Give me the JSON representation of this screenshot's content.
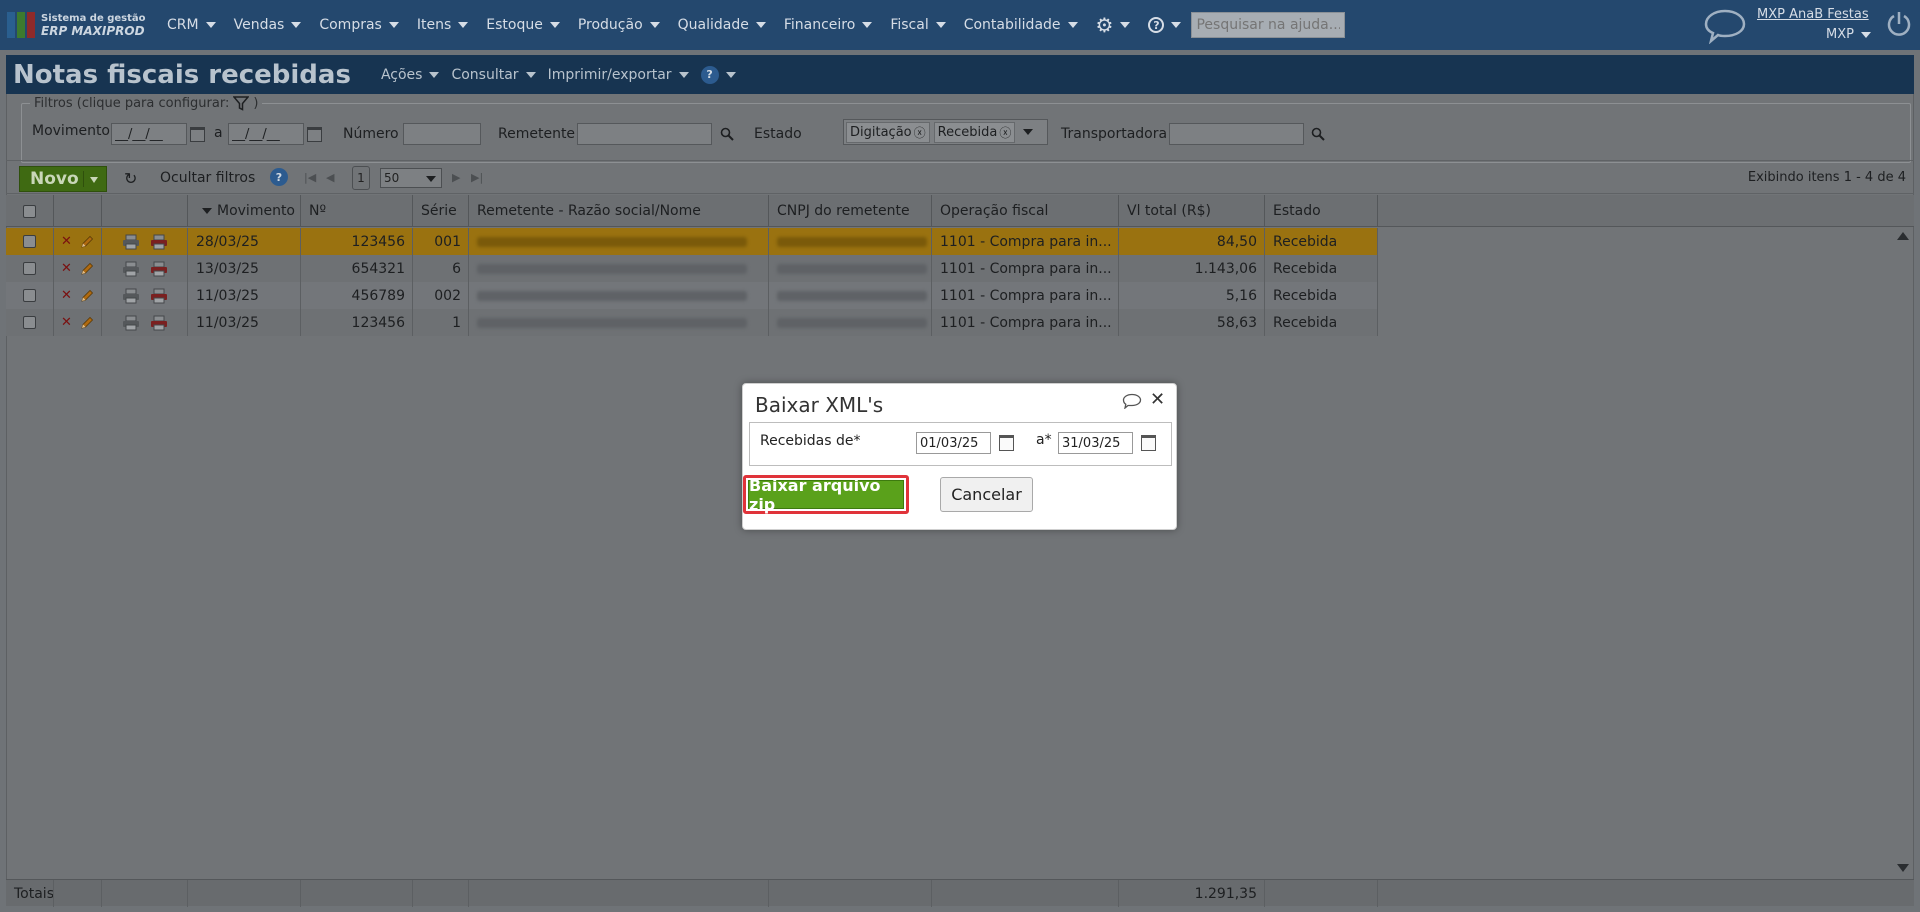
{
  "topbar": {
    "logo_line1": "Sistema de gestão",
    "logo_line2": "ERP MAXIPROD",
    "menu": [
      {
        "label": "CRM"
      },
      {
        "label": "Vendas"
      },
      {
        "label": "Compras"
      },
      {
        "label": "Itens"
      },
      {
        "label": "Estoque"
      },
      {
        "label": "Produção"
      },
      {
        "label": "Qualidade"
      },
      {
        "label": "Financeiro"
      },
      {
        "label": "Fiscal"
      },
      {
        "label": "Contabilidade"
      }
    ],
    "help_search_placeholder": "Pesquisar na ajuda...",
    "user_name": "MXP AnaB Festas",
    "company": "MXP",
    "icons": [
      "gear-icon",
      "help-icon",
      "chat-icon",
      "power-icon"
    ]
  },
  "header": {
    "title": "Notas fiscais recebidas",
    "menus": [
      "Ações",
      "Consultar",
      "Imprimir/exportar"
    ],
    "help_symbol": "?"
  },
  "filters": {
    "legend": "Filtros (clique para configurar:",
    "legend_end": ")",
    "movimento_label": "Movimento",
    "date_from": "__/__/__",
    "date_sep": "a",
    "date_to": "__/__/__",
    "numero_label": "Número",
    "numero_value": "",
    "remetente_label": "Remetente",
    "remetente_value": "",
    "estado_label": "Estado",
    "estado_tags": [
      "Digitação",
      "Recebida"
    ],
    "transportadora_label": "Transportadora",
    "transportadora_value": ""
  },
  "toolbar": {
    "novo_label": "Novo",
    "hide_filters_label": "Ocultar filtros",
    "help_symbol": "?",
    "page": "1",
    "page_size": "50",
    "count_text": "Exibindo itens 1 - 4 de 4"
  },
  "grid": {
    "columns": [
      "Movimento",
      "Nº",
      "Série",
      "Remetente - Razão social/Nome",
      "CNPJ do remetente",
      "Operação fiscal",
      "Vl total (R$)",
      "Estado"
    ],
    "rows": [
      {
        "movimento": "28/03/25",
        "numero": "123456",
        "serie": "001",
        "operacao": "1101 - Compra para in...",
        "total": "84,50",
        "estado": "Recebida",
        "selected": true
      },
      {
        "movimento": "13/03/25",
        "numero": "654321",
        "serie": "6",
        "operacao": "1101 - Compra para in...",
        "total": "1.143,06",
        "estado": "Recebida",
        "selected": false
      },
      {
        "movimento": "11/03/25",
        "numero": "456789",
        "serie": "002",
        "operacao": "1101 - Compra para in...",
        "total": "5,16",
        "estado": "Recebida",
        "selected": false
      },
      {
        "movimento": "11/03/25",
        "numero": "123456",
        "serie": "1",
        "operacao": "1101 - Compra para in...",
        "total": "58,63",
        "estado": "Recebida",
        "selected": false
      }
    ],
    "totals_label": "Totais:",
    "totals_value": "1.291,35"
  },
  "dialog": {
    "title": "Baixar XML's",
    "recebidas_label": "Recebidas de*",
    "date_from": "01/03/25",
    "date_sep": "a*",
    "date_to": "31/03/25",
    "download_label": "Baixar arquivo zip",
    "cancel_label": "Cancelar"
  },
  "colors": {
    "topbar": "#24486e",
    "header": "#173451",
    "accent_green": "#5aa11b",
    "highlight_red": "#e0333a",
    "selected_row": "#9a7210"
  }
}
